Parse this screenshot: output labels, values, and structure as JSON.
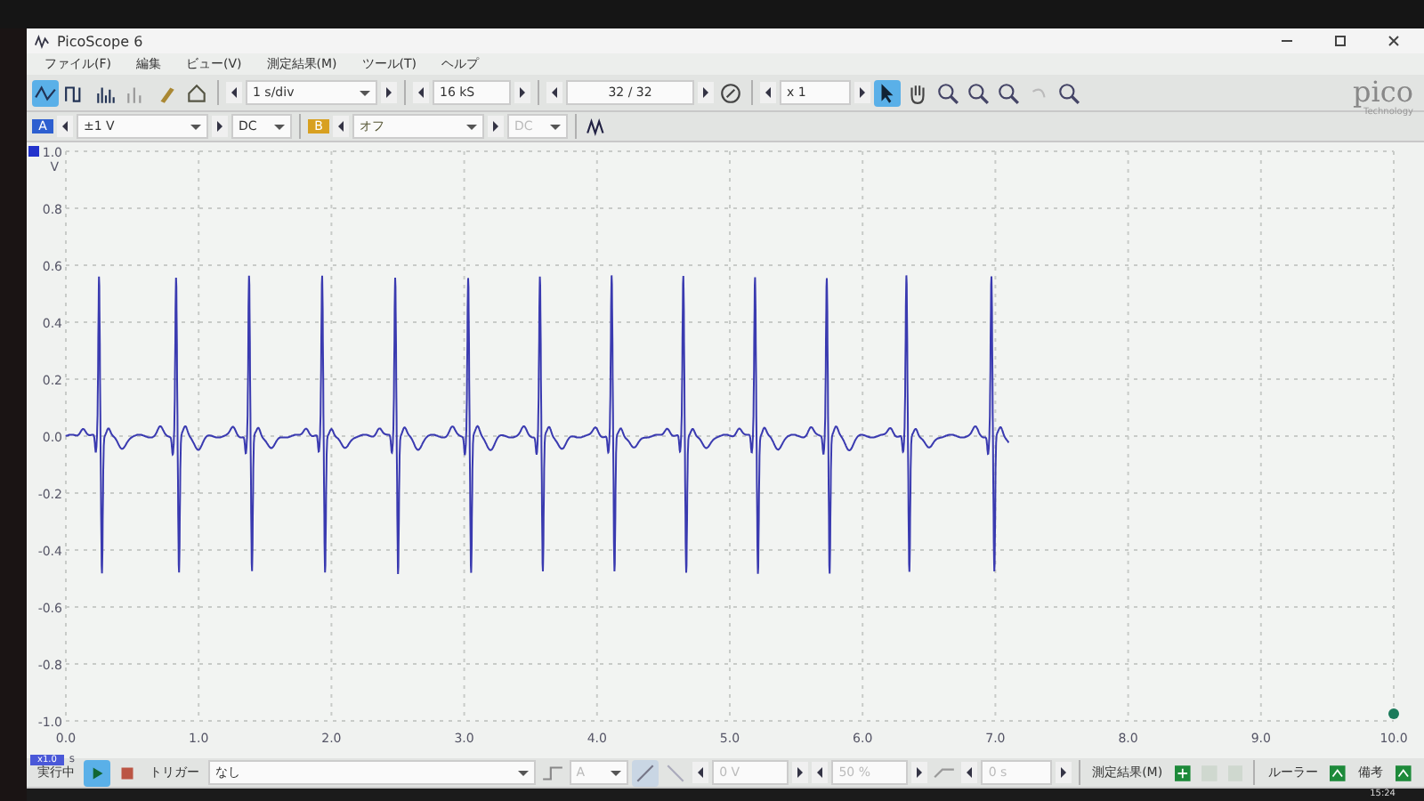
{
  "window": {
    "title": "PicoScope 6"
  },
  "menu": [
    "ファイル(F)",
    "編集",
    "ビュー(V)",
    "測定結果(M)",
    "ツール(T)",
    "ヘルプ"
  ],
  "toolbar": {
    "timebase": "1 s/div",
    "samples": "16 kS",
    "buffer": "32 / 32",
    "zoom": "x 1"
  },
  "channels": [
    {
      "label": "A",
      "range": "±1 V",
      "coupling": "DC",
      "disabled": false
    },
    {
      "label": "B",
      "range": "オフ",
      "coupling": "DC",
      "disabled": true
    }
  ],
  "logo": {
    "name": "pico",
    "tagline": "Technology"
  },
  "plot": {
    "y_unit": "V",
    "x_unit": "s",
    "x_scale": "x1.0",
    "yticks": [
      "1.0",
      "0.8",
      "0.6",
      "0.4",
      "0.2",
      "0.0",
      "-0.2",
      "-0.4",
      "-0.6",
      "-0.8",
      "-1.0"
    ],
    "xticks": [
      "0.0",
      "1.0",
      "2.0",
      "3.0",
      "4.0",
      "5.0",
      "6.0",
      "7.0",
      "8.0",
      "9.0",
      "10.0"
    ]
  },
  "bottom_bar": {
    "status": "実行中",
    "trigger_label": "トリガー",
    "trigger_mode": "なし",
    "trigger_channel": "A",
    "threshold": "0 V",
    "pretrigger": "50 %",
    "delay": "0 s",
    "measurements": "測定結果(M)",
    "rulers": "ルーラー",
    "notes": "備考"
  },
  "taskbar": {
    "time": "15:24"
  }
}
